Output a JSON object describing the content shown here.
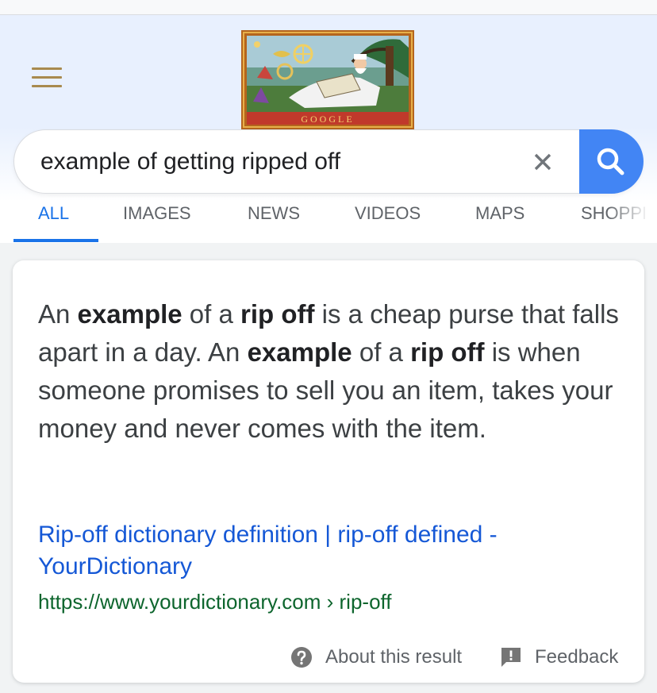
{
  "header": {
    "doodle_word": "GOOGLE"
  },
  "search": {
    "query": "example of getting ripped off"
  },
  "tabs": [
    {
      "label": "ALL"
    },
    {
      "label": "IMAGES"
    },
    {
      "label": "NEWS"
    },
    {
      "label": "VIDEOS"
    },
    {
      "label": "MAPS"
    },
    {
      "label": "SHOPPI"
    }
  ],
  "answer": {
    "segments": [
      {
        "text": "An ",
        "bold": false
      },
      {
        "text": "example",
        "bold": true
      },
      {
        "text": " of a ",
        "bold": false
      },
      {
        "text": "rip off",
        "bold": true
      },
      {
        "text": " is a cheap purse that falls apart in a day. An ",
        "bold": false
      },
      {
        "text": "example",
        "bold": true
      },
      {
        "text": " of a ",
        "bold": false
      },
      {
        "text": "rip off",
        "bold": true
      },
      {
        "text": " is when someone promises to sell you an item, takes your money and never comes with the item.",
        "bold": false
      }
    ]
  },
  "source": {
    "title": "Rip-off dictionary definition | rip-off defined - YourDictionary",
    "url": "https://www.yourdictionary.com › rip-off"
  },
  "footer": {
    "about_label": "About this result",
    "feedback_label": "Feedback"
  },
  "colors": {
    "accent": "#1a73e8",
    "search_button": "#4285f4",
    "link": "#1558d6",
    "url": "#0d652d",
    "menu_icon": "#a88a4e"
  }
}
